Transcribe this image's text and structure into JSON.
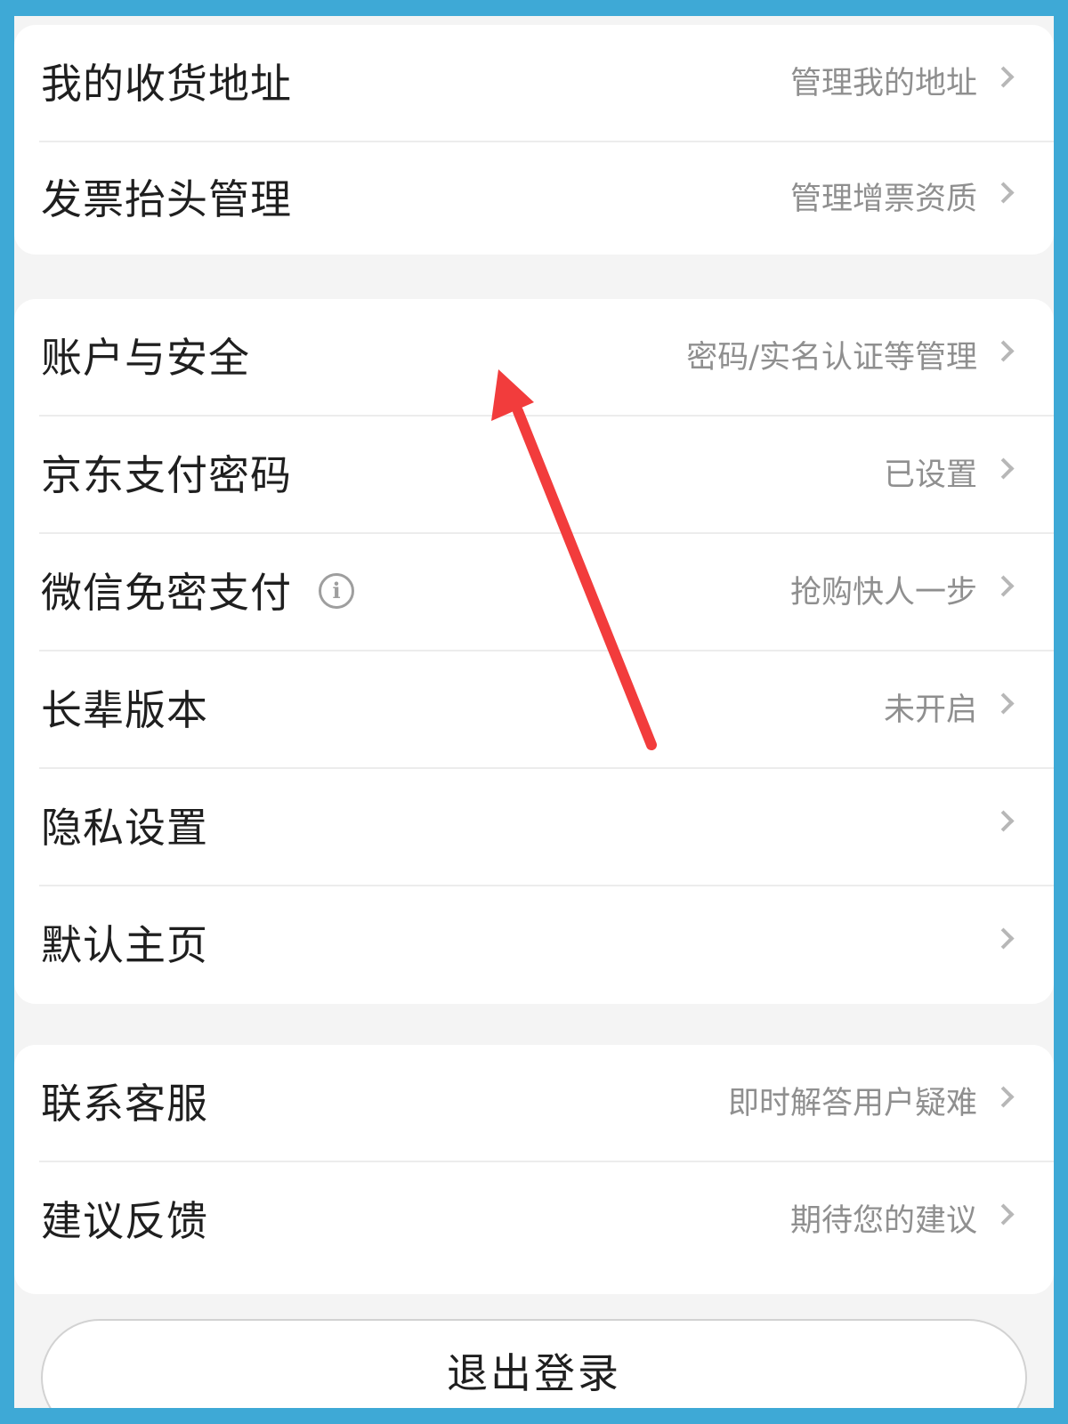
{
  "colors": {
    "border_frame": "#3ea9d6",
    "page_background": "#f4f4f4",
    "card_background": "#ffffff",
    "title_text": "#1f1f1f",
    "value_text": "#8f8f8f",
    "chevron": "#b7b7b7",
    "annotation_arrow": "#f23c3c"
  },
  "sections": [
    {
      "rows": [
        {
          "title": "我的收货地址",
          "value": "管理我的地址",
          "icon": "chevron-right-icon"
        },
        {
          "title": "发票抬头管理",
          "value": "管理增票资质",
          "icon": "chevron-right-icon"
        }
      ]
    },
    {
      "rows": [
        {
          "title": "账户与安全",
          "value": "密码/实名认证等管理",
          "icon": "chevron-right-icon"
        },
        {
          "title": "京东支付密码",
          "value": "已设置",
          "icon": "chevron-right-icon"
        },
        {
          "title": "微信免密支付",
          "value": "抢购快人一步",
          "icon": "chevron-right-icon",
          "info_icon": "info-icon",
          "info_glyph": "i"
        },
        {
          "title": "长辈版本",
          "value": "未开启",
          "icon": "chevron-right-icon"
        },
        {
          "title": "隐私设置",
          "value": "",
          "icon": "chevron-right-icon"
        },
        {
          "title": "默认主页",
          "value": "",
          "icon": "chevron-right-icon"
        }
      ]
    },
    {
      "rows": [
        {
          "title": "联系客服",
          "value": "即时解答用户疑难",
          "icon": "chevron-right-icon"
        },
        {
          "title": "建议反馈",
          "value": "期待您的建议",
          "icon": "chevron-right-icon"
        }
      ]
    }
  ],
  "logout": {
    "label": "退出登录"
  },
  "annotation": {
    "icon": "red-arrow-icon"
  }
}
